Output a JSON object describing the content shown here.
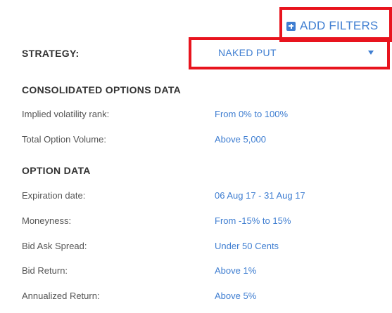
{
  "header": {
    "add_filters_label": "ADD FILTERS"
  },
  "strategy": {
    "label": "STRATEGY:",
    "selected": "NAKED PUT"
  },
  "sections": [
    {
      "title": "CONSOLIDATED OPTIONS DATA",
      "rows": [
        {
          "label": "Implied volatility rank:",
          "value": "From 0% to 100%"
        },
        {
          "label": "Total Option Volume:",
          "value": "Above 5,000"
        }
      ]
    },
    {
      "title": "OPTION DATA",
      "rows": [
        {
          "label": "Expiration date:",
          "value": "06 Aug 17 - 31 Aug 17"
        },
        {
          "label": "Moneyness:",
          "value": "From -15% to 15%"
        },
        {
          "label": "Bid Ask Spread:",
          "value": "Under 50 Cents"
        },
        {
          "label": "Bid Return:",
          "value": "Above 1%"
        },
        {
          "label": "Annualized Return:",
          "value": "Above 5%"
        }
      ]
    }
  ],
  "colors": {
    "accent": "#3f7ed1",
    "highlight": "#e8141e"
  }
}
